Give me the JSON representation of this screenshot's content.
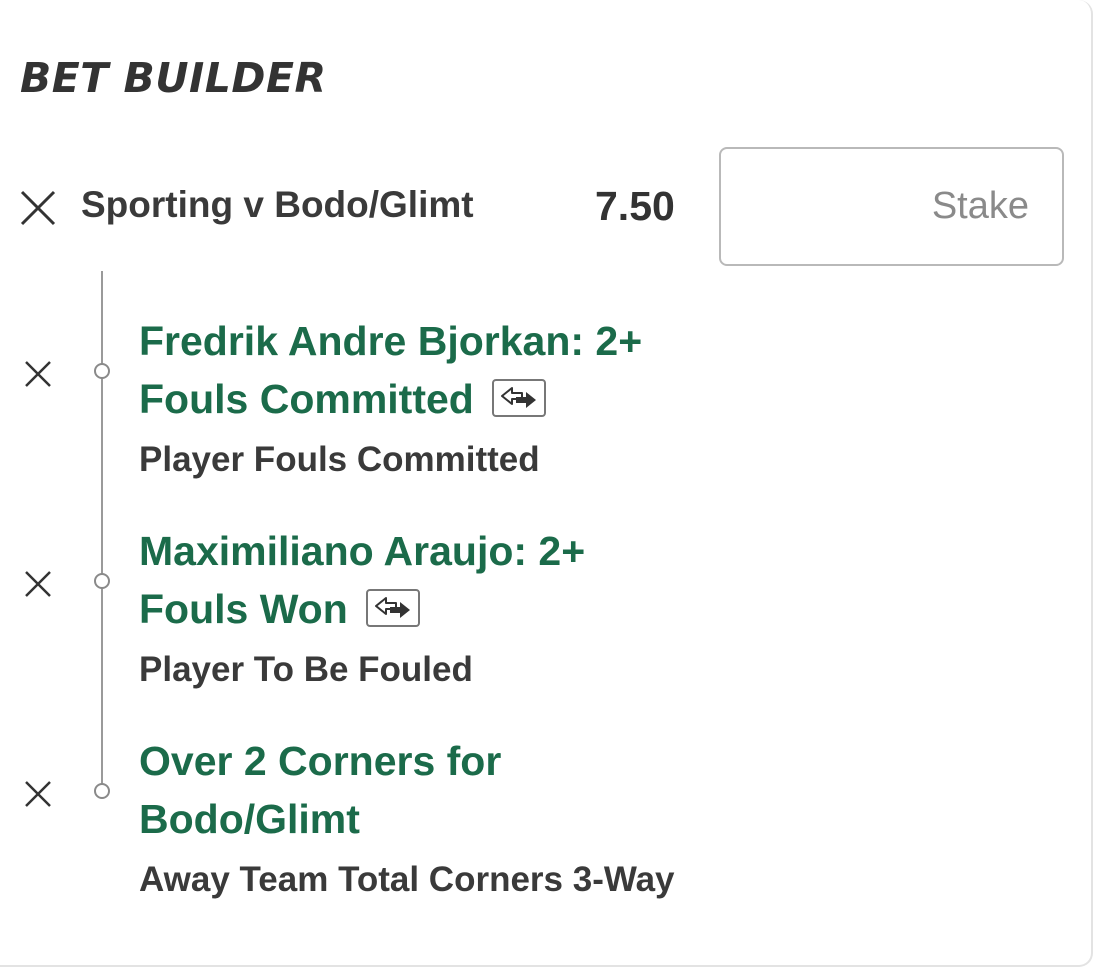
{
  "header": {
    "title": "BET BUILDER"
  },
  "event": {
    "name": "Sporting v Bodo/Glimt",
    "odds": "7.50",
    "stake_placeholder": "Stake"
  },
  "selections": [
    {
      "title_line1": "Fredrik Andre Bjorkan: 2+",
      "title_line2": "Fouls Committed",
      "market": "Player Fouls Committed",
      "has_swap_icon": true
    },
    {
      "title_line1": "Maximiliano Araujo: 2+",
      "title_line2": "Fouls Won",
      "market": "Player To Be Fouled",
      "has_swap_icon": true
    },
    {
      "title_line1": "Over 2 Corners for",
      "title_line2": "Bodo/Glimt",
      "market": "Away Team Total Corners 3-Way",
      "has_swap_icon": false
    }
  ],
  "icons": {
    "remove": "close-icon",
    "swap": "swap-arrows-icon",
    "node": "timeline-node-icon"
  },
  "colors": {
    "selection_green": "#1b6b4a",
    "text_dark": "#333333",
    "border": "#b9b9b9"
  }
}
